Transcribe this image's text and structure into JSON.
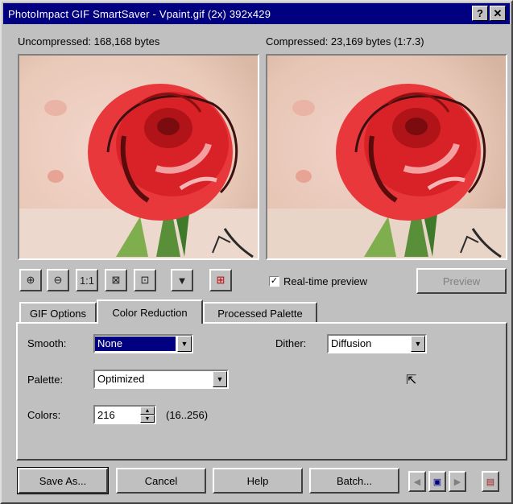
{
  "window": {
    "title": "PhotoImpact GIF SmartSaver - Vpaint.gif (2x) 392x429",
    "help_label": "?",
    "close_label": "✕"
  },
  "previews": {
    "uncompressed_label": "Uncompressed: 168,168 bytes",
    "compressed_label": "Compressed: 23,169 bytes (1:7.3)"
  },
  "toolbar": {
    "tools": [
      {
        "name": "zoom-in-icon",
        "glyph": "⊕"
      },
      {
        "name": "zoom-out-icon",
        "glyph": "⊖"
      },
      {
        "name": "actual-size-icon",
        "glyph": "1:1"
      },
      {
        "name": "fit-window-icon",
        "glyph": "⊠"
      },
      {
        "name": "full-screen-icon",
        "glyph": "⊡"
      },
      {
        "name": "background-color-icon",
        "glyph": "▼"
      },
      {
        "name": "grid-icon",
        "glyph": "⊞"
      }
    ],
    "realtime_preview_label": "Real-time preview",
    "realtime_preview_checked": true,
    "preview_button_label": "Preview"
  },
  "tabs": [
    {
      "label": "GIF Options",
      "active": false
    },
    {
      "label": "Color Reduction",
      "active": true
    },
    {
      "label": "Processed Palette",
      "active": false
    }
  ],
  "color_reduction": {
    "smooth_label": "Smooth:",
    "smooth_value": "None",
    "dither_label": "Dither:",
    "dither_value": "Diffusion",
    "palette_label": "Palette:",
    "palette_value": "Optimized",
    "colors_label": "Colors:",
    "colors_value": "216",
    "colors_range": "(16..256)"
  },
  "footer": {
    "save_as_label": "Save As...",
    "cancel_label": "Cancel",
    "help_label": "Help",
    "batch_label": "Batch..."
  },
  "colors": {
    "titlebar": "#000080",
    "face": "#c0c0c0",
    "selection": "#000080"
  }
}
